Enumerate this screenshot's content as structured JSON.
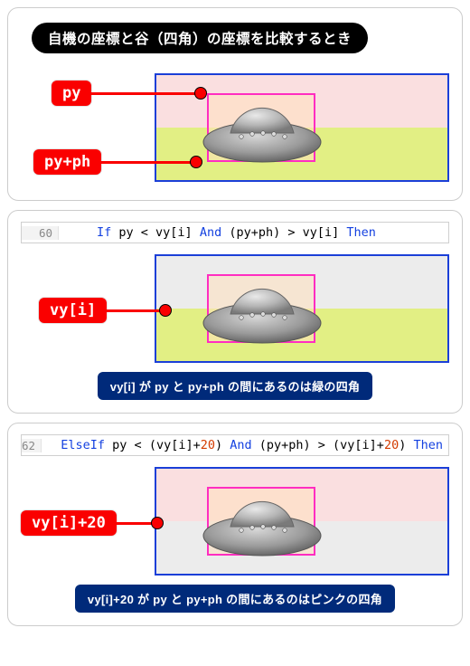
{
  "heading": "自機の座標と谷（四角）の座標を比較するとき",
  "panel1": {
    "labels": {
      "top": "py",
      "bottom": "py+ph"
    }
  },
  "panel2": {
    "code": {
      "ln": "60",
      "kw_if": "If",
      "seg1": " py < vy[i] ",
      "kw_and": "And",
      "seg2": " (py+ph) > vy[i] ",
      "kw_then": "Then"
    },
    "label": "vy[i]",
    "caption": "vy[i] が py と py+ph の間にあるのは緑の四角"
  },
  "panel3": {
    "code": {
      "ln": "62",
      "kw_elseif": "ElseIf",
      "seg1": " py < (vy[i]+",
      "num1": "20",
      "seg2": ") ",
      "kw_and": "And",
      "seg3": " (py+ph) > (vy[i]+",
      "num2": "20",
      "seg4": ") ",
      "kw_then": "Then"
    },
    "label": "vy[i]+20",
    "caption": "vy[i]+20 が py と py+ph の間にあるのはピンクの四角"
  }
}
